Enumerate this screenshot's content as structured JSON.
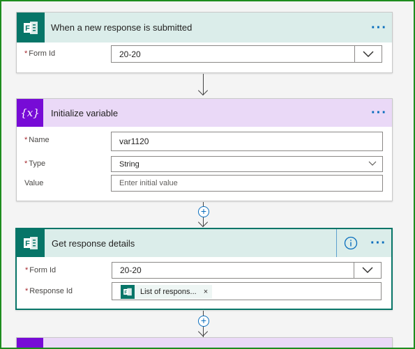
{
  "colors": {
    "forms_brand": "#077568",
    "forms_header_bg": "#dbedea",
    "variable_brand": "#770bd6",
    "variable_header_bg": "#ead9f7",
    "accent": "#0a6ebd",
    "frame_border": "#1e8c1e"
  },
  "trigger": {
    "title": "When a new response is submitted",
    "icon": "forms-icon",
    "menu": "···",
    "form_id": {
      "label": "Form Id",
      "required_mark": "*",
      "value": "20-20",
      "icon": "chevron-down-icon"
    }
  },
  "init_variable": {
    "title": "Initialize variable",
    "icon": "variable-icon",
    "icon_text": "{x}",
    "menu": "···",
    "name": {
      "label": "Name",
      "required_mark": "*",
      "value": "var1120"
    },
    "type": {
      "label": "Type",
      "required_mark": "*",
      "value": "String",
      "icon": "chevron-down-icon"
    },
    "value": {
      "label": "Value",
      "placeholder": "Enter initial value"
    }
  },
  "get_response": {
    "title": "Get response details",
    "icon": "forms-icon",
    "info_icon": "info-icon",
    "menu": "···",
    "form_id": {
      "label": "Form Id",
      "required_mark": "*",
      "value": "20-20",
      "icon": "chevron-down-icon"
    },
    "response_id": {
      "label": "Response Id",
      "required_mark": "*",
      "token_label": "List of respons...",
      "token_remove": "×"
    }
  },
  "insert_step": {
    "plus": "+"
  }
}
